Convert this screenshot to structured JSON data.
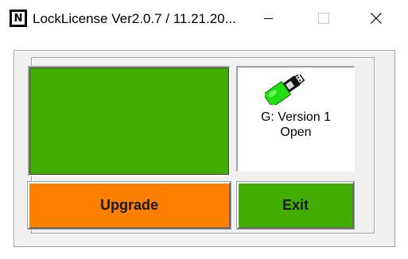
{
  "window": {
    "title": "LockLicense Ver2.0.7 / 11.21.20...",
    "app_icon_letter": "N",
    "controls": [
      "minimize-icon",
      "maximize-icon",
      "close-icon"
    ]
  },
  "status_panel": {
    "color": "#40ad00"
  },
  "drive_info": {
    "icon": "usb-drive-icon",
    "line1": "G: Version 1",
    "line2": "Open"
  },
  "buttons": {
    "upgrade_label": "Upgrade",
    "upgrade_color": "#ff8000",
    "exit_label": "Exit",
    "exit_color": "#40ad00"
  }
}
